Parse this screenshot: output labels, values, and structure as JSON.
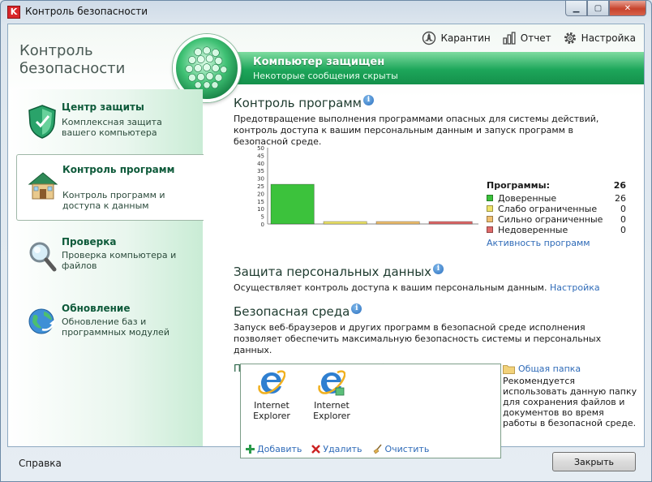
{
  "window": {
    "title": "Контроль безопасности"
  },
  "brand": {
    "line1": "Контроль",
    "line2": "безопасности"
  },
  "top_nav": [
    {
      "label": "Карантин",
      "icon": "quarantine-icon"
    },
    {
      "label": "Отчет",
      "icon": "report-icon"
    },
    {
      "label": "Настройка",
      "icon": "gear-icon"
    }
  ],
  "status": {
    "title": "Компьютер защищен",
    "subtitle": "Некоторые сообщения скрыты"
  },
  "sidebar": {
    "items": [
      {
        "title": "Центр защиты",
        "desc": "Комплексная защита вашего компьютера",
        "icon": "shield-icon"
      },
      {
        "title": "Контроль программ",
        "desc": "Контроль программ и доступа к данным",
        "icon": "house-icon"
      },
      {
        "title": "Проверка",
        "desc": "Проверка компьютера и файлов",
        "icon": "magnifier-icon"
      },
      {
        "title": "Обновление",
        "desc": "Обновление баз и программных модулей",
        "icon": "globe-update-icon"
      }
    ]
  },
  "app_control": {
    "title": "Контроль программ",
    "desc": "Предотвращение выполнения программами опасных для системы действий, контроль доступа к вашим персональным данным и запуск программ в безопасной среде.",
    "legend_title": "Программы:",
    "legend_total": "26",
    "legend": [
      {
        "label": "Доверенные",
        "count": "26",
        "color": "#3cc23c"
      },
      {
        "label": "Слабо ограниченные",
        "count": "0",
        "color": "#eee36a"
      },
      {
        "label": "Сильно ограниченные",
        "count": "0",
        "color": "#f0c070"
      },
      {
        "label": "Недоверенные",
        "count": "0",
        "color": "#e06a6a"
      }
    ],
    "activity_link": "Активность программ"
  },
  "chart_data": {
    "type": "bar",
    "categories": [
      "Доверенные",
      "Слабо ограниченные",
      "Сильно ограниченные",
      "Недоверенные"
    ],
    "values": [
      26,
      0,
      0,
      0
    ],
    "colors": [
      "#3cc23c",
      "#eee36a",
      "#f0c070",
      "#e06a6a"
    ],
    "yticks": [
      "0",
      "5",
      "10",
      "15",
      "20",
      "25",
      "30",
      "35",
      "40",
      "45",
      "50"
    ],
    "ylim": [
      0,
      50
    ],
    "grid": false
  },
  "personal_data": {
    "title": "Защита персональных данных",
    "desc": "Осуществляет контроль доступа к вашим персональным данным.",
    "link": "Настройка"
  },
  "safe_env": {
    "title": "Безопасная среда",
    "desc": "Запуск веб-браузеров и других программ в безопасной среде исполнения позволяет обеспечить максимальную безопасность системы и персональных данных.",
    "list_label": "Программы, запускаемые в безопасной среде:",
    "apps": [
      {
        "name": "Internet Explorer",
        "icon": "internet-explorer-icon"
      },
      {
        "name": "Internet Explorer",
        "icon": "internet-explorer-sandbox-icon"
      }
    ],
    "actions": {
      "add": "Добавить",
      "remove": "Удалить",
      "clear": "Очистить"
    },
    "shared_folder": {
      "link": "Общая папка",
      "desc": "Рекомендуется использовать данную папку для сохранения файлов и документов во время работы в безопасной среде."
    }
  },
  "footer": {
    "help": "Справка",
    "close": "Закрыть"
  }
}
